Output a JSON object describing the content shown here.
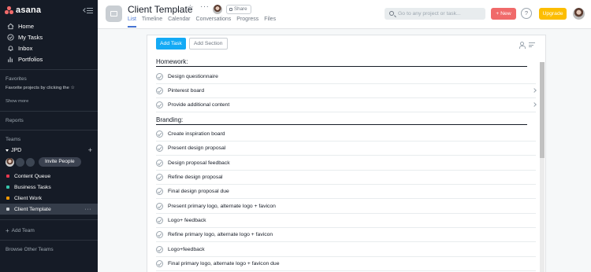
{
  "sidebar": {
    "logo_text": "asana",
    "nav": [
      {
        "label": "Home",
        "icon": "home-icon"
      },
      {
        "label": "My Tasks",
        "icon": "check-circle-icon"
      },
      {
        "label": "Inbox",
        "icon": "bell-icon"
      },
      {
        "label": "Portfolios",
        "icon": "bar-chart-icon"
      }
    ],
    "favorites_title": "Favorites",
    "favorites_hint": "Favorite projects by clicking the ☆",
    "show_more": "Show more",
    "reports": "Reports",
    "teams_title": "Teams",
    "team_name": "JPD",
    "invite_label": "Invite People",
    "projects": [
      {
        "label": "Content Queue",
        "color": "#e8384f"
      },
      {
        "label": "Business Tasks",
        "color": "#37c5ab"
      },
      {
        "label": "Client Work",
        "color": "#fd9a00"
      },
      {
        "label": "Client Template",
        "color": "#c9ced3"
      }
    ],
    "more_glyph": "···",
    "add_team": "Add Team",
    "browse_teams": "Browse Other Teams"
  },
  "header": {
    "title": "Client Template",
    "share_label": "Share",
    "tabs": [
      "List",
      "Timeline",
      "Calendar",
      "Conversations",
      "Progress",
      "Files"
    ],
    "search_placeholder": "Go to any project or task...",
    "new_label": "+ New",
    "help_label": "?",
    "upgrade_label": "Upgrade"
  },
  "toolbar": {
    "add_task": "Add Task",
    "add_section": "Add Section"
  },
  "sections": [
    {
      "title": "Homework:",
      "tasks": [
        "Design questionnaire",
        "Pinterest board",
        "Provide additional content"
      ]
    },
    {
      "title": "Branding:",
      "tasks": [
        "Create inspiration board",
        "Present design proposal",
        "Design proposal feedback",
        "Refine design proposal",
        "Final design proposal due",
        "Present primary logo, alternate logo + favicon",
        "Logo+ feedback",
        "Refine primary logo, alternate logo + favicon",
        "Logo+feedback",
        "Final primary logo, alternate logo + favicon due"
      ]
    }
  ],
  "colors": {
    "sidebar_bg": "#151b26",
    "accent_blue": "#14aaf5",
    "tab_active": "#4573d2",
    "new_button": "#f06a6a",
    "upgrade_button": "#fcbd01"
  }
}
